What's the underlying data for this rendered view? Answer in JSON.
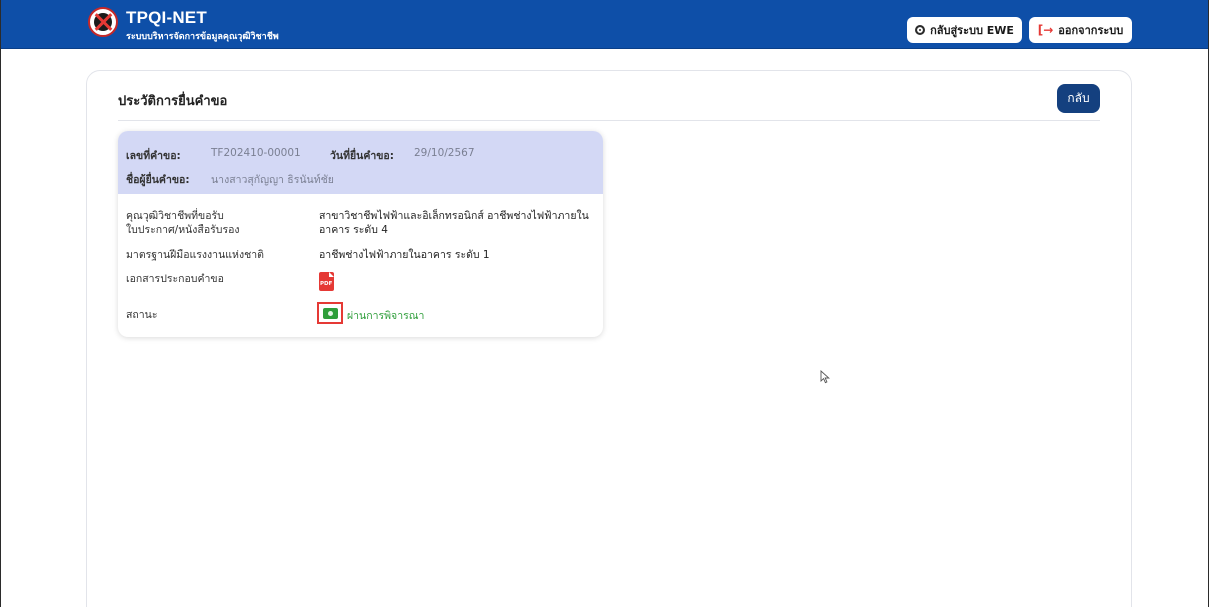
{
  "header": {
    "brand_title": "TPQI-NET",
    "brand_subtitle": "ระบบบริหารจัดการข้อมูลคุณวุฒิวิชาชีพ",
    "btn_ewe": "กลับสู่ระบบ EWE",
    "btn_logout": "ออกจากระบบ"
  },
  "page": {
    "title": "ประวัติการยื่นคำขอ",
    "back_button": "กลับ"
  },
  "request": {
    "number_label": "เลขที่คำขอ:",
    "number_value": "TF202410-00001",
    "date_label": "วันที่ยื่นคำขอ:",
    "date_value": "29/10/2567",
    "name_label": "ชื่อผู้ยื่นคำขอ:",
    "name_value": "นางสาวสุกัญญา ธิรนันท์ชัย",
    "rows": {
      "qualification_label_1": "คุณวุฒิวิชาชีพที่ขอรับ",
      "qualification_label_2": "ใบประกาศ/หนังสือรับรอง",
      "qualification_value_1": "สาขาวิชาชีพไฟฟ้าและอิเล็กทรอนิกส์ อาชีพช่างไฟฟ้าภายใน",
      "qualification_value_2": "อาคาร ระดับ 4",
      "standard_label": "มาตรฐานฝีมือแรงงานแห่งชาติ",
      "standard_value": "อาชีพช่างไฟฟ้าภายในอาคาร ระดับ 1",
      "documents_label": "เอกสารประกอบคำขอ",
      "pdf_text": "PDF",
      "status_label": "สถานะ",
      "status_value": "ผ่านการพิจารณา"
    }
  },
  "colors": {
    "header_bg": "#0e4fa8",
    "back_button_bg": "#14407f",
    "request_header_bg": "#d3d8f5",
    "status_green": "#2e9e3a",
    "highlight_red": "#e53935"
  },
  "icons": {
    "logo": "tpqi-logo",
    "ewe": "circle-icon",
    "logout": "logout-arrow-icon",
    "pdf": "pdf-file-icon",
    "status": "money-icon",
    "cursor": "mouse-cursor-icon"
  }
}
